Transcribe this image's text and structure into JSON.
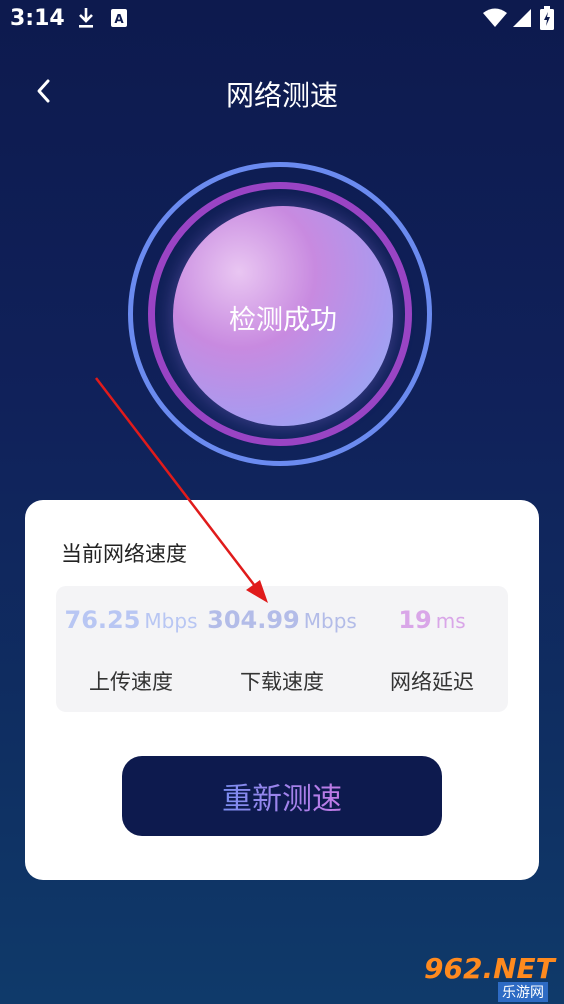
{
  "status_bar": {
    "time": "3:14",
    "icons": [
      "download-icon",
      "a-icon",
      "wifi-icon",
      "signal-icon",
      "battery-icon"
    ]
  },
  "header": {
    "back_icon": "chevron-left-icon",
    "title": "网络测速"
  },
  "speed_circle": {
    "status_text": "检测成功"
  },
  "result_card": {
    "title": "当前网络速度",
    "stats": [
      {
        "value": "76.25",
        "unit": "Mbps",
        "label": "上传速度",
        "color": "#b8c6f3"
      },
      {
        "value": "304.99",
        "unit": "Mbps",
        "label": "下载速度",
        "color": "#b3bce8"
      },
      {
        "value": "19",
        "unit": "ms",
        "label": "网络延迟",
        "color": "#d9a6e8"
      }
    ],
    "retest_label": "重新测速"
  },
  "watermark": {
    "brand": "962.NET",
    "sub": "乐游网"
  },
  "colors": {
    "background_top": "#0d1a4e",
    "button_bg": "#0d1a4e",
    "ring_outer": "#6b8bf0",
    "ring_mid": "#9a44c4",
    "annotation_arrow": "#e01b1b"
  }
}
